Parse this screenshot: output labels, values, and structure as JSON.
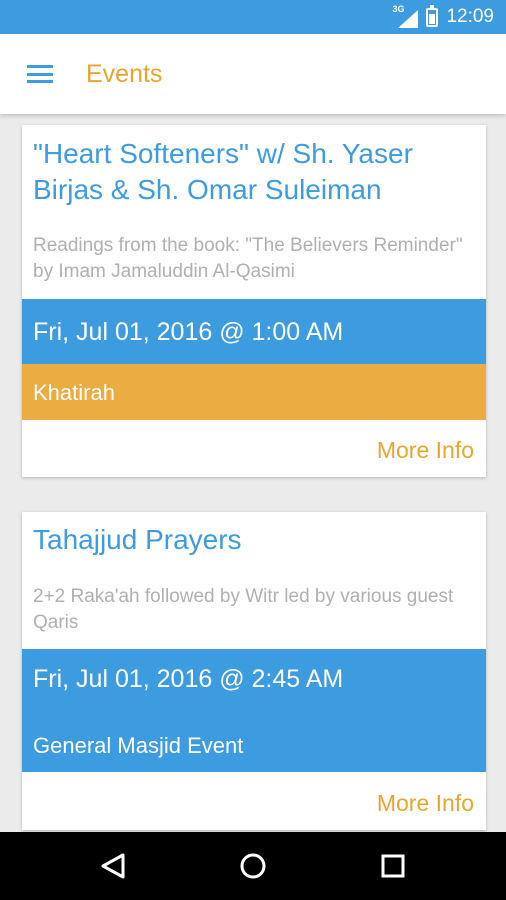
{
  "status_bar": {
    "time": "12:09",
    "network": "3G",
    "icons": [
      "signal-icon",
      "battery-icon"
    ]
  },
  "app_bar": {
    "title": "Events",
    "menu_icon": "hamburger-menu-icon"
  },
  "colors": {
    "primary": "#3d9be0",
    "accent": "#e8a630",
    "khatirah": "#ebad41",
    "description": "#b0b0b0"
  },
  "events": [
    {
      "title": "\"Heart Softeners\" w/ Sh. Yaser Birjas & Sh. Omar Suleiman",
      "description": "Readings from the book: \"The Believers Reminder\" by Imam Jamaluddin Al-Qasimi",
      "datetime": "Fri, Jul 01, 2016 @ 1:00 AM",
      "category": "Khatirah",
      "more_label": "More Info"
    },
    {
      "title": "Tahajjud Prayers",
      "description": "2+2 Raka'ah followed by Witr led by various guest Qaris",
      "datetime": "Fri, Jul 01, 2016 @ 2:45 AM",
      "category": "General Masjid Event",
      "more_label": "More Info"
    }
  ],
  "nav_bar": {
    "icons": [
      "back-icon",
      "home-icon",
      "recent-apps-icon"
    ]
  }
}
